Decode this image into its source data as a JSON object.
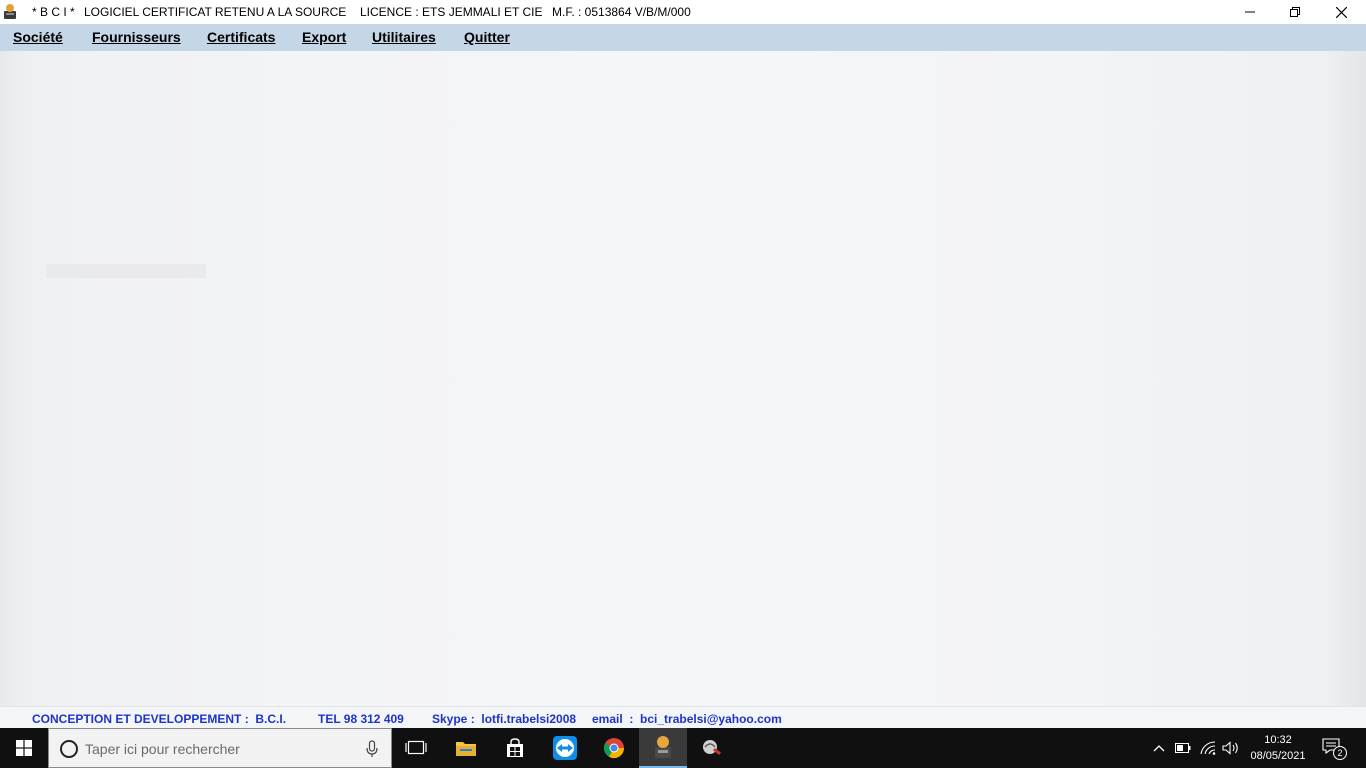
{
  "window": {
    "title_app": "* B C I *",
    "title_product": "LOGICIEL CERTIFICAT RETENU A LA SOURCE",
    "title_licence": "LICENCE : ETS JEMMALI ET CIE",
    "title_mf": "M.F. : 0513864 V/B/M/000",
    "icons": {
      "app": "bci-app-icon",
      "minimize": "minimize-icon",
      "restore": "restore-icon",
      "close": "close-icon"
    }
  },
  "menu": {
    "items": [
      {
        "label": "Société"
      },
      {
        "label": "Fournisseurs"
      },
      {
        "label": "Certificats"
      },
      {
        "label": "Export"
      },
      {
        "label": "Utilitaires"
      },
      {
        "label": "Quitter"
      }
    ]
  },
  "footer": {
    "conception": "CONCEPTION ET DEVELOPPEMENT :  B.C.I.",
    "tel": "TEL 98 312 409",
    "skype": "Skype :  lotfi.trabelsi2008",
    "email": "email  :  bci_trabelsi@yahoo.com",
    "color": "#1d35c8"
  },
  "taskbar": {
    "search_placeholder": "Taper ici pour rechercher",
    "apps": [
      {
        "name": "task-view-icon"
      },
      {
        "name": "file-explorer-icon"
      },
      {
        "name": "store-icon"
      },
      {
        "name": "teamviewer-icon"
      },
      {
        "name": "chrome-icon"
      },
      {
        "name": "bci-app-icon",
        "active": true
      },
      {
        "name": "tool-app-icon"
      }
    ],
    "tray": {
      "icons": [
        "chevron-up-icon",
        "battery-icon",
        "wifi-icon",
        "volume-icon"
      ],
      "time": "10:32",
      "date": "08/05/2021",
      "notification_count": "2"
    }
  },
  "colors": {
    "menubar": "#c5d6e6",
    "workspace": "#f3f4f6",
    "taskbar": "#101010"
  }
}
